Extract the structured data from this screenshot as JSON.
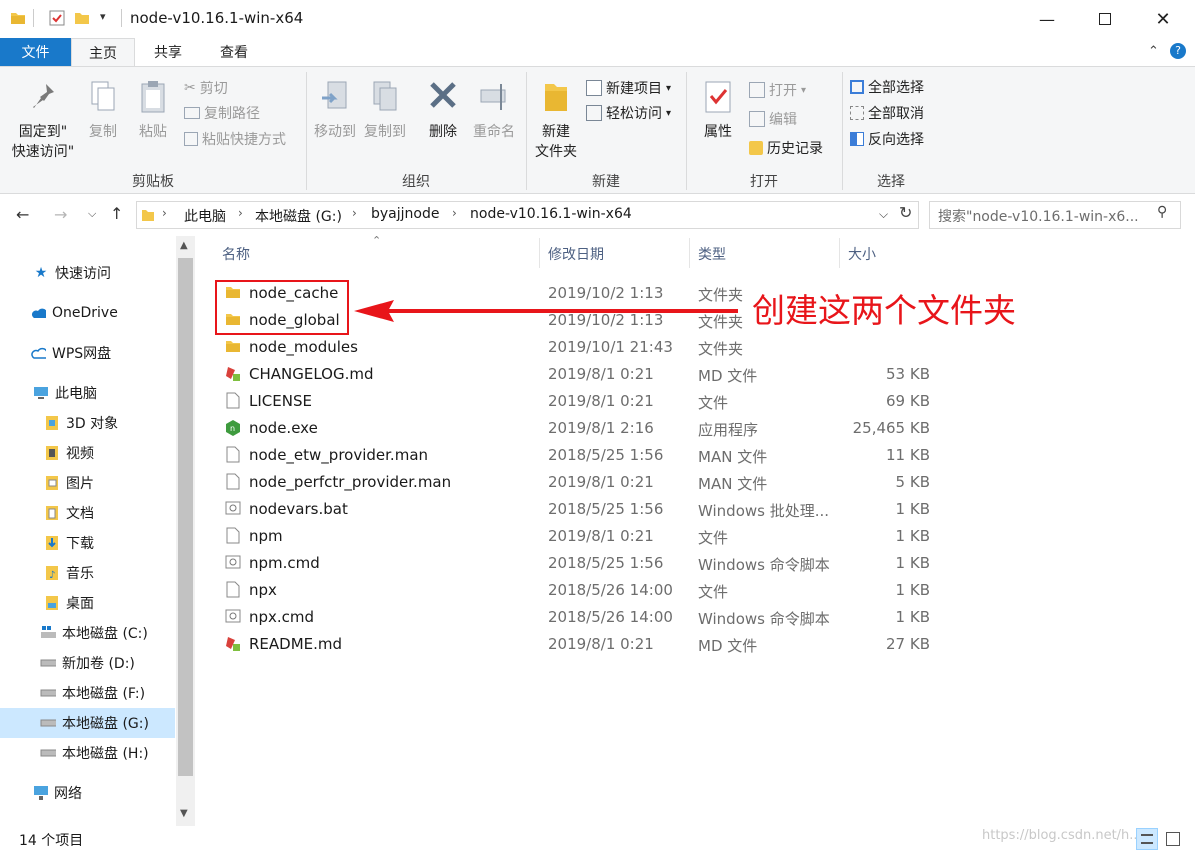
{
  "window": {
    "title": "node-v10.16.1-win-x64"
  },
  "tabs": {
    "file": "文件",
    "home": "主页",
    "share": "共享",
    "view": "查看"
  },
  "ribbon": {
    "clipboard": {
      "label": "剪贴板",
      "pin_line1": "固定到\"",
      "pin_line2": "快速访问\"",
      "copy": "复制",
      "paste": "粘贴",
      "cut": "剪切",
      "copy_path": "复制路径",
      "paste_shortcut": "粘贴快捷方式"
    },
    "organize": {
      "label": "组织",
      "move_to": "移动到",
      "copy_to": "复制到",
      "delete": "删除",
      "rename": "重命名"
    },
    "new": {
      "label": "新建",
      "new_folder_line1": "新建",
      "new_folder_line2": "文件夹",
      "new_item": "新建项目",
      "easy_access": "轻松访问"
    },
    "open": {
      "label": "打开",
      "properties": "属性",
      "open": "打开",
      "edit": "编辑",
      "history": "历史记录"
    },
    "select": {
      "label": "选择",
      "select_all": "全部选择",
      "select_none": "全部取消",
      "invert": "反向选择"
    }
  },
  "address": {
    "crumbs": [
      "此电脑",
      "本地磁盘 (G:)",
      "byajjnode",
      "node-v10.16.1-win-x64"
    ],
    "search_placeholder": "搜索\"node-v10.16.1-win-x6..."
  },
  "nav": {
    "items": [
      "快速访问",
      "OneDrive",
      "WPS网盘",
      "此电脑",
      "3D 对象",
      "视频",
      "图片",
      "文档",
      "下载",
      "音乐",
      "桌面",
      "本地磁盘 (C:)",
      "新加卷 (D:)",
      "本地磁盘 (F:)",
      "本地磁盘 (G:)",
      "本地磁盘 (H:)",
      "网络"
    ]
  },
  "columns": {
    "name": "名称",
    "date": "修改日期",
    "type": "类型",
    "size": "大小"
  },
  "files": [
    {
      "name": "node_cache",
      "date": "2019/10/2 1:13",
      "type": "文件夹",
      "size": "",
      "icon": "folder-icon"
    },
    {
      "name": "node_global",
      "date": "2019/10/2 1:13",
      "type": "文件夹",
      "size": "",
      "icon": "folder-icon"
    },
    {
      "name": "node_modules",
      "date": "2019/10/1 21:43",
      "type": "文件夹",
      "size": "",
      "icon": "folder-icon"
    },
    {
      "name": "CHANGELOG.md",
      "date": "2019/8/1 0:21",
      "type": "MD 文件",
      "size": "53 KB",
      "icon": "md-file-icon"
    },
    {
      "name": "LICENSE",
      "date": "2019/8/1 0:21",
      "type": "文件",
      "size": "69 KB",
      "icon": "file-icon"
    },
    {
      "name": "node.exe",
      "date": "2019/8/1 2:16",
      "type": "应用程序",
      "size": "25,465 KB",
      "icon": "node-exe-icon"
    },
    {
      "name": "node_etw_provider.man",
      "date": "2018/5/25 1:56",
      "type": "MAN 文件",
      "size": "11 KB",
      "icon": "file-icon"
    },
    {
      "name": "node_perfctr_provider.man",
      "date": "2019/8/1 0:21",
      "type": "MAN 文件",
      "size": "5 KB",
      "icon": "file-icon"
    },
    {
      "name": "nodevars.bat",
      "date": "2018/5/25 1:56",
      "type": "Windows 批处理...",
      "size": "1 KB",
      "icon": "bat-file-icon"
    },
    {
      "name": "npm",
      "date": "2019/8/1 0:21",
      "type": "文件",
      "size": "1 KB",
      "icon": "file-icon"
    },
    {
      "name": "npm.cmd",
      "date": "2018/5/25 1:56",
      "type": "Windows 命令脚本",
      "size": "1 KB",
      "icon": "bat-file-icon"
    },
    {
      "name": "npx",
      "date": "2018/5/26 14:00",
      "type": "文件",
      "size": "1 KB",
      "icon": "file-icon"
    },
    {
      "name": "npx.cmd",
      "date": "2018/5/26 14:00",
      "type": "Windows 命令脚本",
      "size": "1 KB",
      "icon": "bat-file-icon"
    },
    {
      "name": "README.md",
      "date": "2019/8/1 0:21",
      "type": "MD 文件",
      "size": "27 KB",
      "icon": "md-file-icon"
    }
  ],
  "status": {
    "count": "14 个项目",
    "watermark": "https://blog.csdn.net/h..."
  },
  "annotation": {
    "text": "创建这两个文件夹",
    "color": "#e8151a"
  },
  "colors": {
    "accent": "#1979ca",
    "selected": "#cce8ff",
    "folder": "#f3c74a"
  }
}
